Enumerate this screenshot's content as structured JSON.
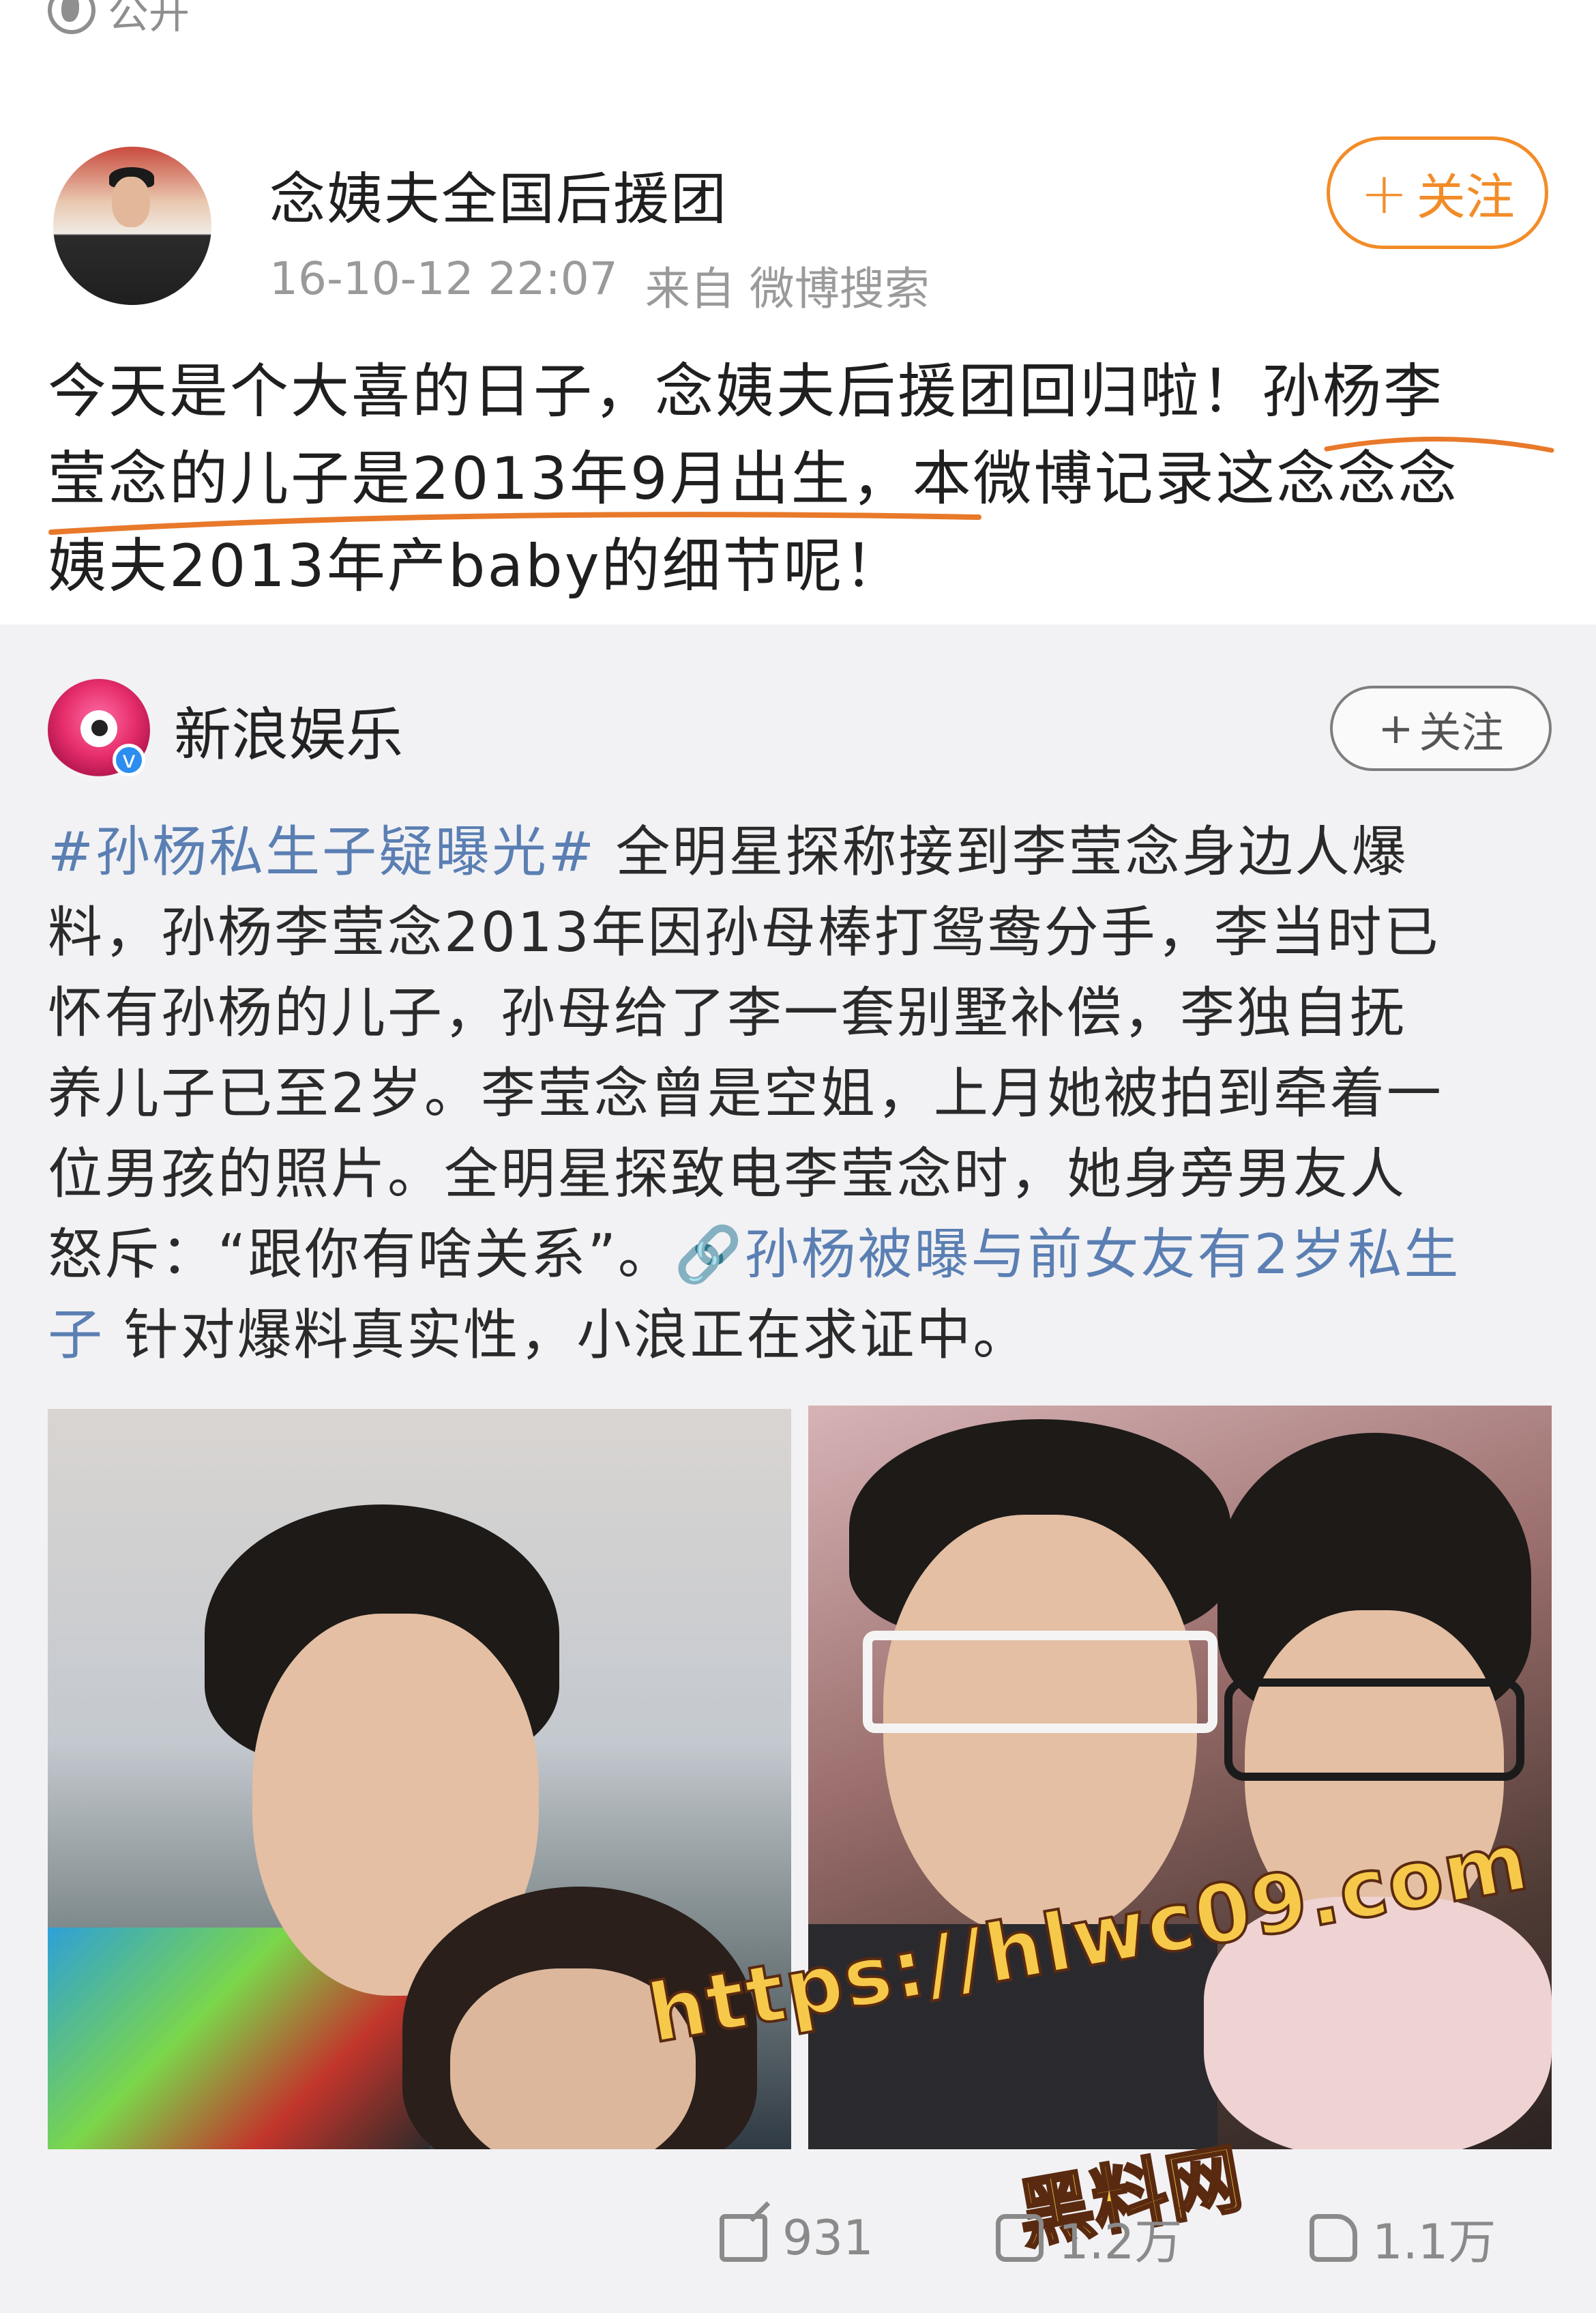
{
  "top": {
    "visibility_label": "公开"
  },
  "post1": {
    "author": "念姨夫全国后援团",
    "timestamp": "16-10-12 22:07",
    "source": "来自 微博搜索",
    "follow_label": "关注",
    "text_lines": [
      "今天是个大喜的日子，念姨夫后援团回归啦！孙杨李",
      "莹念的儿子是2013年9月出生，本微博记录这念念念",
      "姨夫2013年产baby的细节呢！"
    ],
    "underline_color": "#e8792a"
  },
  "repost": {
    "author": "新浪娱乐",
    "verified_badge": "v",
    "follow_label": "关注",
    "hashtag": "#孙杨私生子疑曝光#",
    "text_line1": " 全明星探称接到李莹念身边人爆",
    "text_lines": [
      "料，孙杨李莹念2013年因孙母棒打鸳鸯分手，李当时已",
      "怀有孙杨的儿子，孙母给了李一套别墅补偿，李独自抚",
      "养儿子已至2岁。李莹念曾是空姐，上月她被拍到牵着一",
      "位男孩的照片。全明星探致电李莹念时，她身旁男友人"
    ],
    "text_line6": "怒斥：“跟你有啥关系”。",
    "link_text": "孙杨被曝与前女友有2岁私生",
    "link_tail": "子",
    "text_last": " 针对爆料真实性，小浪正在求证中。",
    "link_color": "#5b7fb3"
  },
  "watermark": {
    "url": "https://hlwc09.com",
    "label": "黑料网"
  },
  "actions": {
    "share_count": "931",
    "comment_count": "1.2万",
    "like_count": "1.1万"
  },
  "colors": {
    "follow_orange": "#f28c28",
    "verified_blue": "#2b8ef0"
  }
}
